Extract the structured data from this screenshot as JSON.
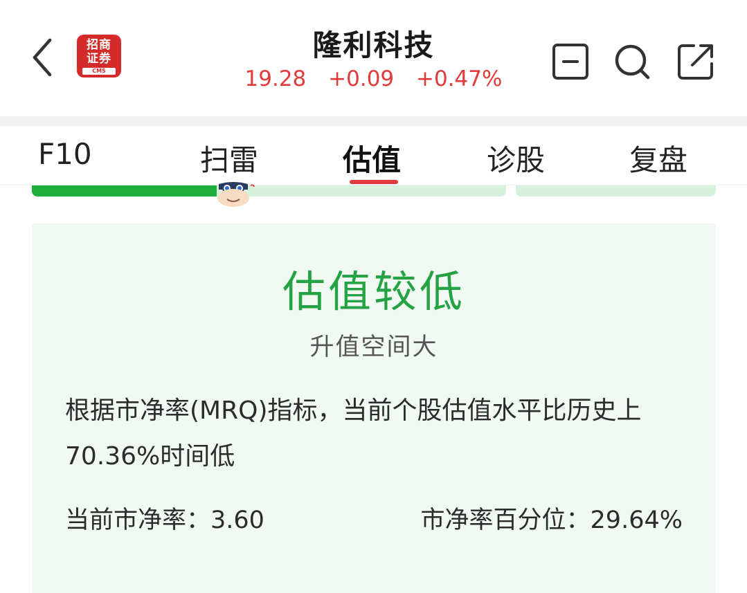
{
  "header": {
    "back_icon": "chevron-left-icon",
    "logo": {
      "line1": "招商",
      "line2": "证券",
      "en": "CMS",
      "color": "#d42a2a"
    },
    "title": "隆利科技",
    "price": "19.28",
    "change": "+0.09",
    "change_pct": "+0.47%",
    "quote_color": "#e13a3a",
    "icons": [
      "minus-box-icon",
      "search-icon",
      "share-icon"
    ]
  },
  "tabs": {
    "items": [
      {
        "label": "F10"
      },
      {
        "label": "扫雷"
      },
      {
        "label": "估值"
      },
      {
        "label": "诊股"
      },
      {
        "label": "复盘"
      }
    ],
    "active_index": 2,
    "active_color": "#e03a3a"
  },
  "valuation_meter": {
    "fill_fraction": 0.39,
    "fill_color": "#1fad3b",
    "track_color": "#d6f2dc"
  },
  "card": {
    "verdict": "估值较低",
    "verdict_color": "#25a344",
    "subverdict": "升值空间大",
    "description": "根据市净率(MRQ)指标，当前个股估值水平比历史上70.36%时间低",
    "pb_label": "当前市净率：",
    "pb_value": "3.60",
    "pb_pct_label": "市净率百分位：",
    "pb_pct_value": "29.64%",
    "background": "#f0faf3"
  }
}
